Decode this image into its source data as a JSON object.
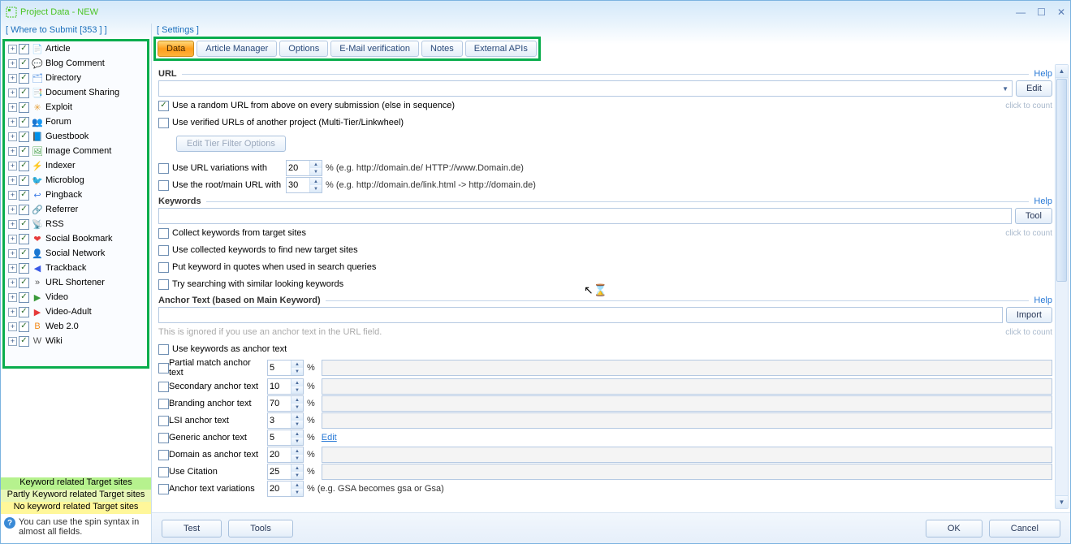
{
  "window": {
    "title": "Project Data - NEW"
  },
  "wincontrols": {
    "min": "—",
    "max": "☐",
    "close": "✕"
  },
  "left": {
    "header": "[ Where to Submit  [353 ] ]",
    "items": [
      {
        "label": "Article",
        "ico": "📄",
        "c": "#6aa0e6"
      },
      {
        "label": "Blog Comment",
        "ico": "💬",
        "c": "#888"
      },
      {
        "label": "Directory",
        "ico": "🗂",
        "c": "#6aa0e6"
      },
      {
        "label": "Document Sharing",
        "ico": "📑",
        "c": "#7a9a3a"
      },
      {
        "label": "Exploit",
        "ico": "✳",
        "c": "#e6a03a"
      },
      {
        "label": "Forum",
        "ico": "👥",
        "c": "#e67a1a"
      },
      {
        "label": "Guestbook",
        "ico": "📘",
        "c": "#5a7aca"
      },
      {
        "label": "Image Comment",
        "ico": "🖼",
        "c": "#3a9a3a"
      },
      {
        "label": "Indexer",
        "ico": "⚡",
        "c": "#e6c01a"
      },
      {
        "label": "Microblog",
        "ico": "🐦",
        "c": "#4ab4e6"
      },
      {
        "label": "Pingback",
        "ico": "↩",
        "c": "#3a7ae6"
      },
      {
        "label": "Referrer",
        "ico": "🔗",
        "c": "#888"
      },
      {
        "label": "RSS",
        "ico": "📡",
        "c": "#f28a1a"
      },
      {
        "label": "Social Bookmark",
        "ico": "❤",
        "c": "#e63a3a"
      },
      {
        "label": "Social Network",
        "ico": "👤",
        "c": "#3a7ae6"
      },
      {
        "label": "Trackback",
        "ico": "◀",
        "c": "#3a5ae6"
      },
      {
        "label": "URL Shortener",
        "ico": "»",
        "c": "#555"
      },
      {
        "label": "Video",
        "ico": "▶",
        "c": "#3a9a3a"
      },
      {
        "label": "Video-Adult",
        "ico": "▶",
        "c": "#e63a3a"
      },
      {
        "label": "Web 2.0",
        "ico": "B",
        "c": "#f28a1a"
      },
      {
        "label": "Wiki",
        "ico": "W",
        "c": "#555"
      }
    ],
    "legend": {
      "a": "Keyword related Target sites",
      "b": "Partly Keyword related Target sites",
      "c": "No keyword related Target sites"
    },
    "hint": "You can use the spin syntax in almost all fields."
  },
  "tabs": {
    "settings_label": "[ Settings ]",
    "items": [
      "Data",
      "Article Manager",
      "Options",
      "E-Mail verification",
      "Notes",
      "External APIs"
    ]
  },
  "url": {
    "title": "URL",
    "help": "Help",
    "edit": "Edit",
    "clickcount": "click to count",
    "random": "Use a random URL from above on every submission (else in sequence)",
    "verified": "Use verified URLs of another project (Multi-Tier/Linkwheel)",
    "tierbtn": "Edit Tier Filter Options",
    "var": "Use URL variations with",
    "var_v": "20",
    "var_h": "% (e.g. http://domain.de/ HTTP://www.Domain.de)",
    "root": "Use the root/main URL with",
    "root_v": "30",
    "root_h": "% (e.g. http://domain.de/link.html -> http://domain.de)"
  },
  "kw": {
    "title": "Keywords",
    "help": "Help",
    "tool": "Tool",
    "clickcount": "click to count",
    "c1": "Collect keywords from target sites",
    "c2": "Use collected keywords to find new target sites",
    "c3": "Put keyword in quotes when used in search queries",
    "c4": "Try searching with similar looking keywords"
  },
  "anchor": {
    "title": "Anchor Text (based on Main Keyword)",
    "help": "Help",
    "import": "Import",
    "note": "This is ignored if you use an anchor text in the URL field.",
    "clickcount": "click to count",
    "usekw": "Use keywords as anchor text",
    "rows": [
      {
        "label": "Partial match anchor text",
        "v": "5",
        "extra": ""
      },
      {
        "label": "Secondary anchor text",
        "v": "10",
        "extra": ""
      },
      {
        "label": "Branding anchor text",
        "v": "70",
        "extra": ""
      },
      {
        "label": "LSI anchor text",
        "v": "3",
        "extra": ""
      },
      {
        "label": "Generic anchor text",
        "v": "5",
        "extra": "Edit",
        "link": true
      },
      {
        "label": "Domain as anchor text",
        "v": "20",
        "extra": ""
      },
      {
        "label": "Use Citation",
        "v": "25",
        "extra": ""
      },
      {
        "label": "Anchor text variations",
        "v": "20",
        "extra": "% (e.g. GSA becomes gsa or Gsa)",
        "plain": true
      }
    ]
  },
  "footer": {
    "test": "Test",
    "tools": "Tools",
    "ok": "OK",
    "cancel": "Cancel"
  }
}
